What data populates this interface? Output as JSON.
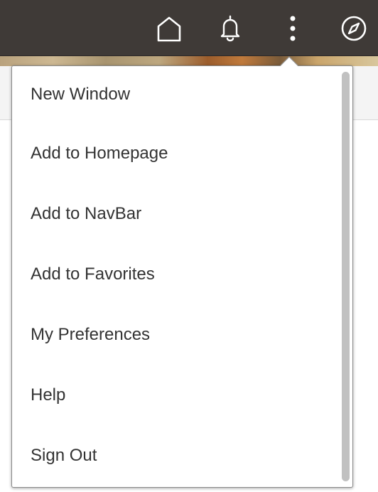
{
  "header": {
    "icons": [
      {
        "name": "home-icon"
      },
      {
        "name": "bell-icon"
      },
      {
        "name": "actions-icon"
      },
      {
        "name": "compass-icon"
      }
    ],
    "bar_color": "#3f3a37",
    "icon_color": "#ffffff"
  },
  "menu": {
    "items": [
      {
        "label": "New Window"
      },
      {
        "label": "Add to Homepage"
      },
      {
        "label": "Add to NavBar"
      },
      {
        "label": "Add to Favorites"
      },
      {
        "label": "My Preferences"
      },
      {
        "label": "Help"
      },
      {
        "label": "Sign Out"
      }
    ],
    "text_color": "#333333"
  }
}
